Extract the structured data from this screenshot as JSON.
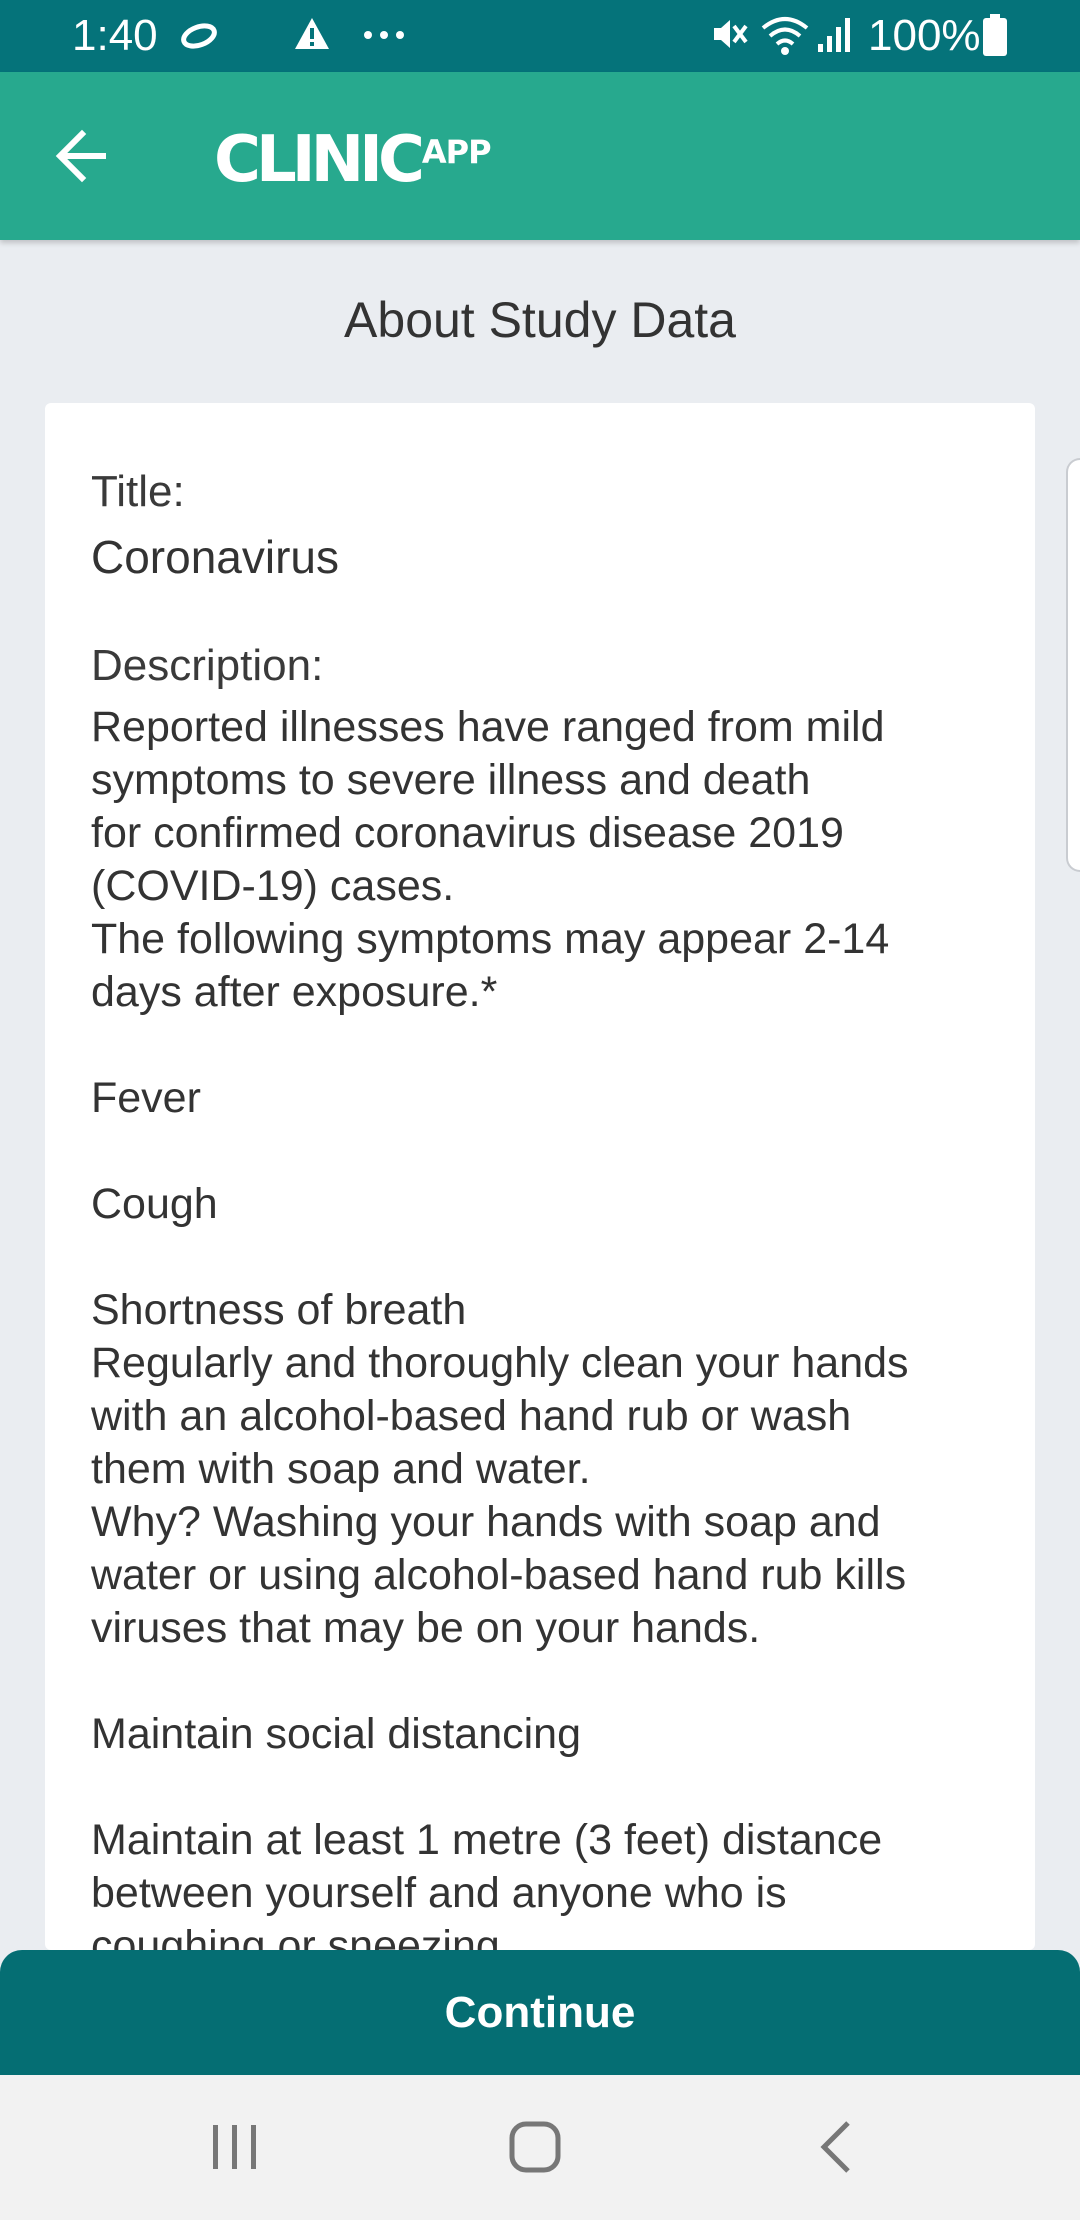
{
  "status_bar": {
    "time": "1:40",
    "battery": "100%",
    "icons": [
      "sync-icon",
      "warning-icon",
      "more-notifications-icon",
      "mute-icon",
      "wifi-icon",
      "signal-icon",
      "battery-icon"
    ]
  },
  "app_bar": {
    "back_icon": "arrow-left-icon",
    "logo_main": "CLINIC",
    "logo_app": "APP"
  },
  "page": {
    "title": "About Study Data"
  },
  "study": {
    "title_label": "Title:",
    "title_value": "Coronavirus",
    "description_label": "Description:",
    "description_text": "Reported illnesses have ranged from mild\nsymptoms to severe illness and death\nfor confirmed coronavirus disease 2019\n(COVID-19) cases.\nThe following symptoms may appear 2-14\ndays after exposure.*\n\nFever\n\nCough\n\nShortness of breath\nRegularly and thoroughly clean your hands\nwith an alcohol-based hand rub or wash\nthem with soap and water.\nWhy? Washing your hands with soap and\nwater or using alcohol-based hand rub kills\nviruses that may be on your hands.\n\nMaintain social distancing\n\nMaintain at least 1 metre (3 feet) distance\nbetween yourself and anyone who is\ncoughing or sneezing."
  },
  "actions": {
    "continue_label": "Continue"
  },
  "nav_bar": {
    "icons": [
      "recent-apps-icon",
      "home-icon",
      "back-icon"
    ]
  },
  "colors": {
    "status_bar": "#05737a",
    "app_bar": "#27a98e",
    "button": "#056e73",
    "background": "#eaedf1"
  }
}
